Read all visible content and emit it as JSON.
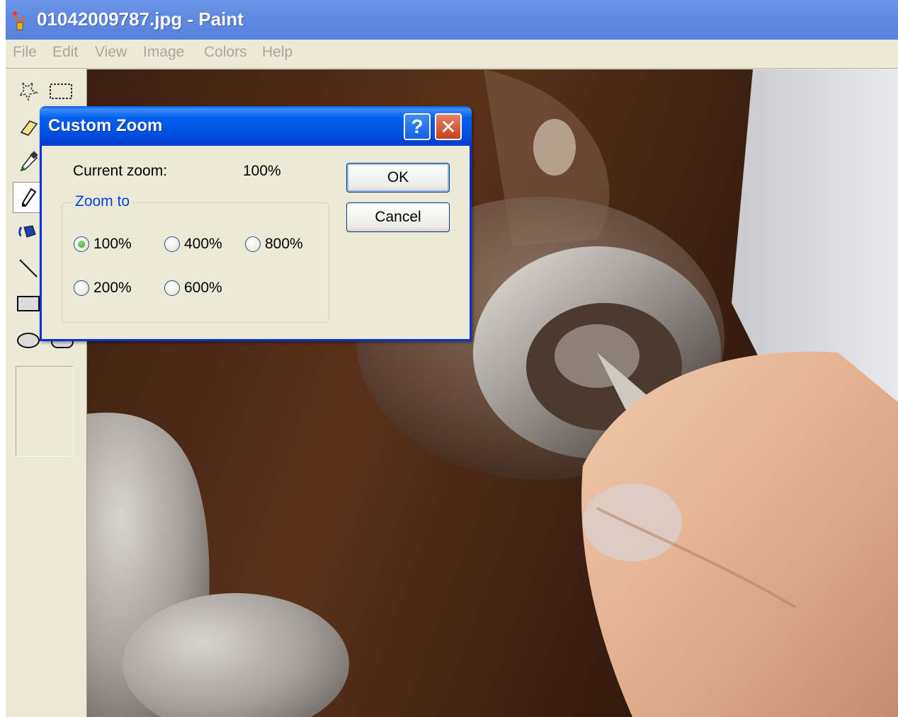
{
  "window": {
    "title": "01042009787.jpg - Paint"
  },
  "menu": {
    "items": [
      "File",
      "Edit",
      "View",
      "Image",
      "Colors",
      "Help"
    ]
  },
  "toolbox": {
    "tools": [
      "free-form-select-icon",
      "rect-select-icon",
      "eraser-icon",
      "pick-color-icon",
      "pencil-icon",
      "fill-icon",
      "line-icon",
      "rectangle-icon",
      "ellipse-icon",
      "rounded-rect-icon"
    ],
    "selected": "pencil-icon"
  },
  "dialog": {
    "title": "Custom Zoom",
    "current_zoom_label": "Current zoom:",
    "current_zoom_value": "100%",
    "group_label": "Zoom to",
    "options": [
      {
        "label": "100%",
        "checked": true
      },
      {
        "label": "400%",
        "checked": false
      },
      {
        "label": "800%",
        "checked": false
      },
      {
        "label": "200%",
        "checked": false
      },
      {
        "label": "600%",
        "checked": false
      }
    ],
    "ok_label": "OK",
    "cancel_label": "Cancel",
    "help_glyph": "?",
    "close_glyph": "✕"
  },
  "colors": {
    "titlebar": "#6089e2",
    "dialog_title": "#0050e0",
    "face": "#ece9d8",
    "close": "#c3421f"
  }
}
